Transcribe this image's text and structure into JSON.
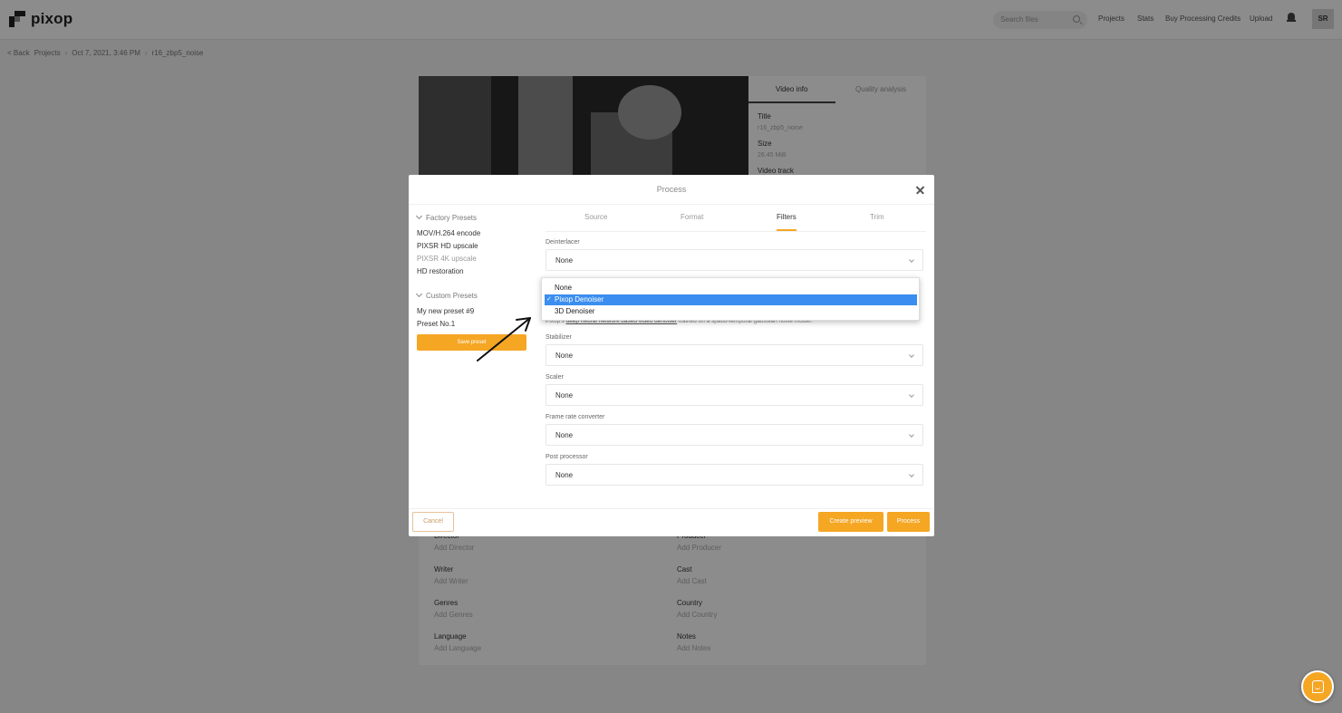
{
  "topbar": {
    "logo_text": "pixop",
    "search_placeholder": "Search files",
    "nav": [
      "Projects",
      "Stats",
      "Buy Processing Credits",
      "Upload"
    ],
    "avatar_initials": "SR"
  },
  "breadcrumb": [
    "< Back",
    "Projects",
    "Oct 7, 2021, 3:46 PM",
    "r16_zbp5_noise"
  ],
  "info_panel": {
    "tabs": [
      "Video info",
      "Quality analysis"
    ],
    "fields": [
      {
        "label": "Title",
        "value": "r16_zbp5_noise"
      },
      {
        "label": "Size",
        "value": "26.45 MiB"
      },
      {
        "label": "Video track",
        "value": ""
      }
    ]
  },
  "metadata": [
    {
      "label": "Director",
      "value": "Add Director"
    },
    {
      "label": "Producer",
      "value": "Add Producer"
    },
    {
      "label": "Writer",
      "value": "Add Writer"
    },
    {
      "label": "Cast",
      "value": "Add Cast"
    },
    {
      "label": "Genres",
      "value": "Add Genres"
    },
    {
      "label": "Country",
      "value": "Add Country"
    },
    {
      "label": "Language",
      "value": "Add Language"
    },
    {
      "label": "Notes",
      "value": "Add Notes"
    }
  ],
  "modal": {
    "title": "Process",
    "factory_presets_title": "Factory Presets",
    "factory_presets": [
      "MOV/H.264 encode",
      "PIXSR HD upscale",
      "PIXSR 4K upscale",
      "HD restoration"
    ],
    "custom_presets_title": "Custom Presets",
    "custom_presets": [
      "My new preset #9",
      "Preset No.1"
    ],
    "save_preset_label": "Save preset",
    "tabs": [
      "Source",
      "Format",
      "Filters",
      "Trim"
    ],
    "active_tab": "Filters",
    "fields": [
      {
        "label": "Deinterlacer",
        "value": "None"
      },
      {
        "label": "Stabilizer",
        "value": "None"
      },
      {
        "label": "Scaler",
        "value": "None"
      },
      {
        "label": "Frame rate converter",
        "value": "None"
      },
      {
        "label": "Post processor",
        "value": "None"
      }
    ],
    "denoiser_dropdown": {
      "options": [
        "None",
        "Pixop Denoiser",
        "3D Denoiser"
      ],
      "selected": "Pixop Denoiser",
      "check": "✓"
    },
    "denoiser_description": {
      "prefix": "Pixop's",
      "link": "deep neural network based video denoiser",
      "suffix": "trained on a spatio-temporal gaussian noise model."
    },
    "cancel_label": "Cancel",
    "preview_label": "Create preview",
    "process_label": "Process"
  },
  "colors": {
    "accent": "#f5a623",
    "selection": "#3b8ef0"
  }
}
